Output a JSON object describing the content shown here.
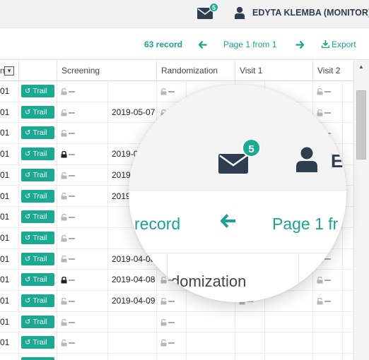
{
  "header": {
    "mail_badge_count": "5",
    "user_name": "EDYTA KLEMBA (MONITOR)"
  },
  "pager": {
    "record_count": "63 record",
    "prev_arrow": "🡐",
    "page_text": "Page 1 from 1",
    "next_arrow": "🡒",
    "export_label": "Export",
    "export_icon": "⤓"
  },
  "table": {
    "columns": [
      "m",
      "",
      "Screening",
      "Randomization",
      "Visit 1",
      "Visit 2"
    ],
    "filter_icon": "▾",
    "trail_label": "Trail",
    "trail_icon": "↺",
    "rows": [
      {
        "id": "01",
        "locked": false,
        "date": "",
        "next_locks": true
      },
      {
        "id": "01",
        "locked": false,
        "date": "2019-05-07",
        "next_locks": true
      },
      {
        "id": "01",
        "locked": false,
        "date": "",
        "next_locks": true
      },
      {
        "id": "01",
        "locked": true,
        "date": "2019-0",
        "next_locks": true
      },
      {
        "id": "01",
        "locked": false,
        "date": "2019-0",
        "next_locks": true
      },
      {
        "id": "01",
        "locked": false,
        "date": "2019",
        "next_locks": true
      },
      {
        "id": "01",
        "locked": false,
        "date": "",
        "next_locks": true
      },
      {
        "id": "01",
        "locked": false,
        "date": "",
        "next_locks": true
      },
      {
        "id": "01",
        "locked": false,
        "date": "2019-04-08",
        "next_locks": true
      },
      {
        "id": "01",
        "locked": true,
        "date": "2019-04-08",
        "next_locks": true
      },
      {
        "id": "01",
        "locked": false,
        "date": "2019-04-09",
        "next_locks": true
      },
      {
        "id": "01",
        "locked": false,
        "date": "",
        "next_locks": false
      },
      {
        "id": "01",
        "locked": false,
        "date": "",
        "next_locks": false
      },
      {
        "id": "01",
        "locked": false,
        "date": "",
        "next_locks": false
      }
    ]
  },
  "magnifier": {
    "badge_count": "5",
    "user_initial": "E",
    "record_text": "record",
    "arrow": "🡐",
    "page_text": "Page 1 fr",
    "column_text": "domization"
  },
  "colors": {
    "accent": "#1aaa91",
    "nav_text": "#2d3e50"
  }
}
